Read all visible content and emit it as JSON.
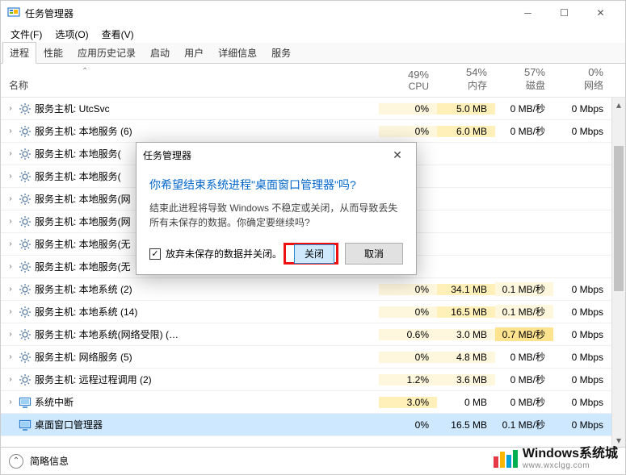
{
  "window": {
    "title": "任务管理器"
  },
  "menu": {
    "file": "文件(F)",
    "options": "选项(O)",
    "view": "查看(V)"
  },
  "tabs": [
    "进程",
    "性能",
    "应用历史记录",
    "启动",
    "用户",
    "详细信息",
    "服务"
  ],
  "active_tab": 0,
  "columns": {
    "name": "名称",
    "cpu": {
      "pct": "49%",
      "lbl": "CPU"
    },
    "mem": {
      "pct": "54%",
      "lbl": "内存"
    },
    "disk": {
      "pct": "57%",
      "lbl": "磁盘"
    },
    "net": {
      "pct": "0%",
      "lbl": "网络"
    }
  },
  "rows": [
    {
      "icon": "gear",
      "name": "服务主机: UtcSvc",
      "cpu": "0%",
      "mem": "5.0 MB",
      "disk": "0 MB/秒",
      "net": "0 Mbps",
      "heat": {
        "cpu": 1,
        "mem": 2,
        "disk": 0,
        "net": 0
      }
    },
    {
      "icon": "gear",
      "name": "服务主机: 本地服务 (6)",
      "cpu": "0%",
      "mem": "6.0 MB",
      "disk": "0 MB/秒",
      "net": "0 Mbps",
      "heat": {
        "cpu": 1,
        "mem": 2,
        "disk": 0,
        "net": 0
      }
    },
    {
      "icon": "gear",
      "name": "服务主机: 本地服务(",
      "cpu": "",
      "mem": "",
      "disk": "",
      "net": "",
      "heat": {}
    },
    {
      "icon": "gear",
      "name": "服务主机: 本地服务(",
      "cpu": "",
      "mem": "",
      "disk": "",
      "net": "",
      "heat": {}
    },
    {
      "icon": "gear",
      "name": "服务主机: 本地服务(网",
      "cpu": "",
      "mem": "",
      "disk": "",
      "net": "",
      "heat": {}
    },
    {
      "icon": "gear",
      "name": "服务主机: 本地服务(网",
      "cpu": "",
      "mem": "",
      "disk": "",
      "net": "",
      "heat": {}
    },
    {
      "icon": "gear",
      "name": "服务主机: 本地服务(无",
      "cpu": "",
      "mem": "",
      "disk": "",
      "net": "",
      "heat": {}
    },
    {
      "icon": "gear",
      "name": "服务主机: 本地服务(无",
      "cpu": "",
      "mem": "",
      "disk": "",
      "net": "",
      "heat": {}
    },
    {
      "icon": "gear",
      "name": "服务主机: 本地系统 (2)",
      "cpu": "0%",
      "mem": "34.1 MB",
      "disk": "0.1 MB/秒",
      "net": "0 Mbps",
      "heat": {
        "cpu": 1,
        "mem": 2,
        "disk": 1,
        "net": 0
      }
    },
    {
      "icon": "gear",
      "name": "服务主机: 本地系统 (14)",
      "cpu": "0%",
      "mem": "16.5 MB",
      "disk": "0.1 MB/秒",
      "net": "0 Mbps",
      "heat": {
        "cpu": 1,
        "mem": 2,
        "disk": 1,
        "net": 0
      }
    },
    {
      "icon": "gear",
      "name": "服务主机: 本地系统(网络受限) (…",
      "cpu": "0.6%",
      "mem": "3.0 MB",
      "disk": "0.7 MB/秒",
      "net": "0 Mbps",
      "heat": {
        "cpu": 1,
        "mem": 1,
        "disk": 3,
        "net": 0
      }
    },
    {
      "icon": "gear",
      "name": "服务主机: 网络服务 (5)",
      "cpu": "0%",
      "mem": "4.8 MB",
      "disk": "0 MB/秒",
      "net": "0 Mbps",
      "heat": {
        "cpu": 1,
        "mem": 1,
        "disk": 0,
        "net": 0
      }
    },
    {
      "icon": "gear",
      "name": "服务主机: 远程过程调用 (2)",
      "cpu": "1.2%",
      "mem": "3.6 MB",
      "disk": "0 MB/秒",
      "net": "0 Mbps",
      "heat": {
        "cpu": 1,
        "mem": 1,
        "disk": 0,
        "net": 0
      }
    },
    {
      "icon": "mon",
      "name": "系统中断",
      "cpu": "3.0%",
      "mem": "0 MB",
      "disk": "0 MB/秒",
      "net": "0 Mbps",
      "heat": {
        "cpu": 2,
        "mem": 0,
        "disk": 0,
        "net": 0
      }
    },
    {
      "icon": "mon",
      "name": "桌面窗口管理器",
      "cpu": "0%",
      "mem": "16.5 MB",
      "disk": "0.1 MB/秒",
      "net": "0 Mbps",
      "selected": true,
      "heat": {
        "cpu": 0,
        "mem": 0,
        "disk": 0,
        "net": 0
      }
    }
  ],
  "dialog": {
    "title": "任务管理器",
    "headline": "你希望结束系统进程\"桌面窗口管理器\"吗?",
    "message": "结束此进程将导致 Windows 不稳定或关闭，从而导致丢失所有未保存的数据。你确定要继续吗?",
    "checkbox_label": "放弃未保存的数据并关闭。",
    "checked": true,
    "primary": "关闭",
    "secondary": "取消"
  },
  "footer": {
    "label": "简略信息"
  },
  "watermark": {
    "brand": "Windows系统城",
    "url": "www.wxclgg.com"
  }
}
